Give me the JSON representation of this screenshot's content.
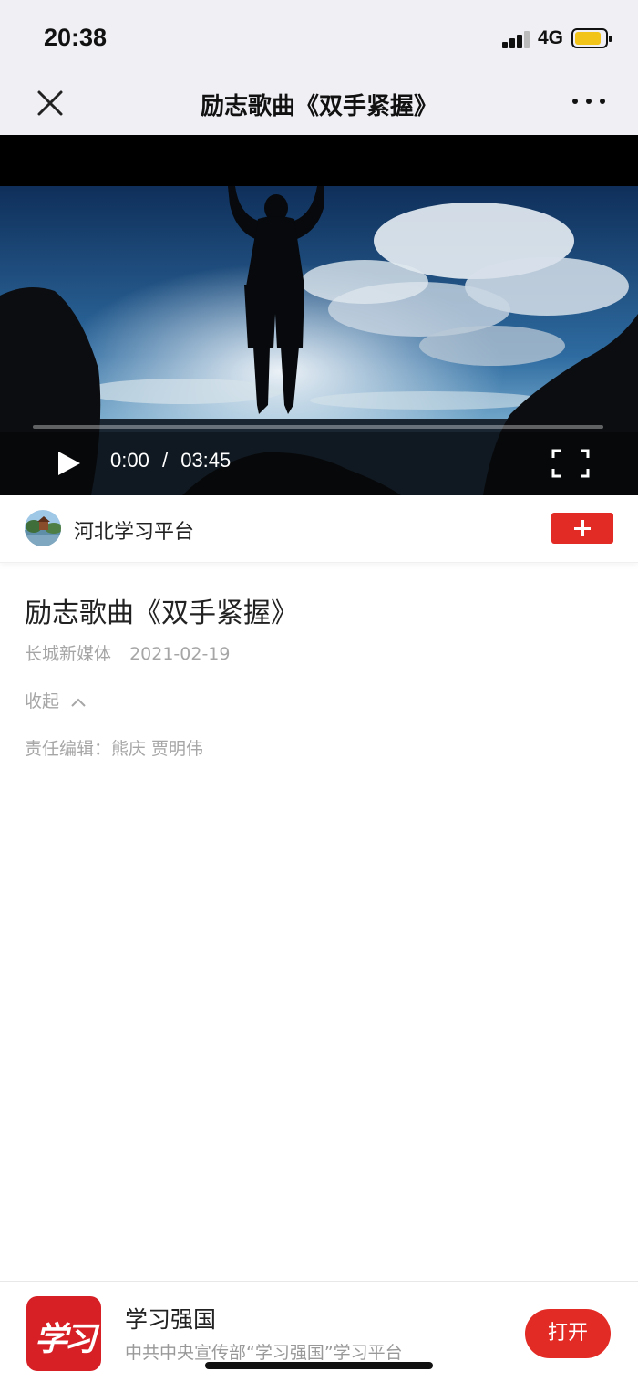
{
  "status_bar": {
    "time": "20:38",
    "network": "4G",
    "battery_color": "#f2c318"
  },
  "nav": {
    "title": "励志歌曲《双手紧握》",
    "close_icon": "close-icon",
    "more_icon": "more-icon"
  },
  "video": {
    "current_time": "0:00",
    "separator": "/",
    "duration": "03:45",
    "progress": 0,
    "play_icon": "play-icon",
    "fullscreen_icon": "fullscreen-icon"
  },
  "channel": {
    "name": "河北学习平台",
    "follow_icon": "plus-icon",
    "accent": "#e32b25"
  },
  "article": {
    "title": "励志歌曲《双手紧握》",
    "source": "长城新媒体",
    "date": "2021-02-19",
    "collapse_label": "收起",
    "editor": "责任编辑：熊庆 贾明伟"
  },
  "app_banner": {
    "name": "学习强国",
    "description": "中共中央宣传部“学习强国”学习平台",
    "open_label": "打开",
    "logo_text": "学习"
  }
}
